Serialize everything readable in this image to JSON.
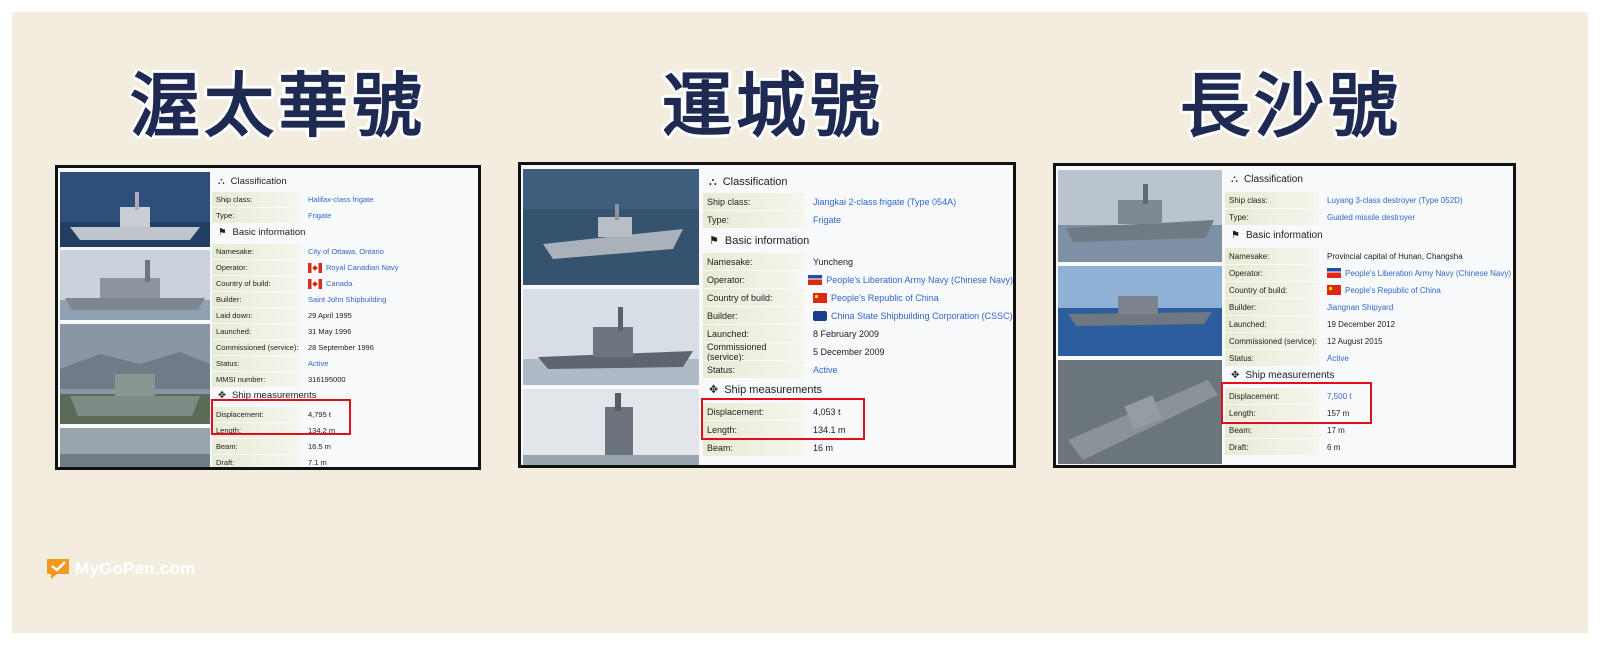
{
  "titles": [
    "渥太華號",
    "運城號",
    "長沙號"
  ],
  "brand": "MyGoPen.com",
  "colors": {
    "background": "#f3ede0",
    "title": "#1f2a52",
    "highlight": "#e0101a",
    "link": "#3366cc"
  },
  "sections": {
    "classification": "Classification",
    "basic": "Basic information",
    "measurements": "Ship measurements"
  },
  "ships": [
    {
      "rows": [
        [
          "Ship class:",
          "Halifax-class frigate"
        ],
        [
          "Type:",
          "Frigate"
        ],
        [
          "Namesake:",
          "City of Ottawa, Ontario"
        ],
        [
          "Operator:",
          "Royal Canadian Navy"
        ],
        [
          "Country of build:",
          "Canada"
        ],
        [
          "Builder:",
          "Saint John Shipbuilding"
        ],
        [
          "Laid down:",
          "29 April 1995"
        ],
        [
          "Launched:",
          "31 May 1996"
        ],
        [
          "Commissioned (service):",
          "28 September 1996"
        ],
        [
          "Status:",
          "Active"
        ],
        [
          "MMSI number:",
          "316195000"
        ],
        [
          "Displacement:",
          "4,795 t"
        ],
        [
          "Length:",
          "134.2 m"
        ],
        [
          "Beam:",
          "16.5 m"
        ],
        [
          "Draft:",
          "7.1 m"
        ]
      ]
    },
    {
      "rows": [
        [
          "Ship class:",
          "Jiangkai 2-class frigate (Type 054A)"
        ],
        [
          "Type:",
          "Frigate"
        ],
        [
          "Namesake:",
          "Yuncheng"
        ],
        [
          "Operator:",
          "People's Liberation Army Navy (Chinese Navy)"
        ],
        [
          "Country of build:",
          "People's Republic of China"
        ],
        [
          "Builder:",
          "China State Shipbuilding Corporation (CSSC)"
        ],
        [
          "Launched:",
          "8 February 2009"
        ],
        [
          "Commissioned (service):",
          "5 December 2009"
        ],
        [
          "Status:",
          "Active"
        ],
        [
          "Displacement:",
          "4,053 t"
        ],
        [
          "Length:",
          "134.1 m"
        ],
        [
          "Beam:",
          "16 m"
        ]
      ]
    },
    {
      "rows": [
        [
          "Ship class:",
          "Luyang 3-class destroyer (Type 052D)"
        ],
        [
          "Type:",
          "Guided missile destroyer"
        ],
        [
          "Namesake:",
          "Provincial capital of Hunan, Changsha"
        ],
        [
          "Operator:",
          "People's Liberation Army Navy (Chinese Navy)"
        ],
        [
          "Country of build:",
          "People's Republic of China"
        ],
        [
          "Builder:",
          "Jiangnan Shipyard"
        ],
        [
          "Launched:",
          "19 December 2012"
        ],
        [
          "Commissioned (service):",
          "12 August 2015"
        ],
        [
          "Status:",
          "Active"
        ],
        [
          "Displacement:",
          "7,500 t"
        ],
        [
          "Length:",
          "157 m"
        ],
        [
          "Beam:",
          "17 m"
        ],
        [
          "Draft:",
          "6 m"
        ]
      ]
    }
  ]
}
